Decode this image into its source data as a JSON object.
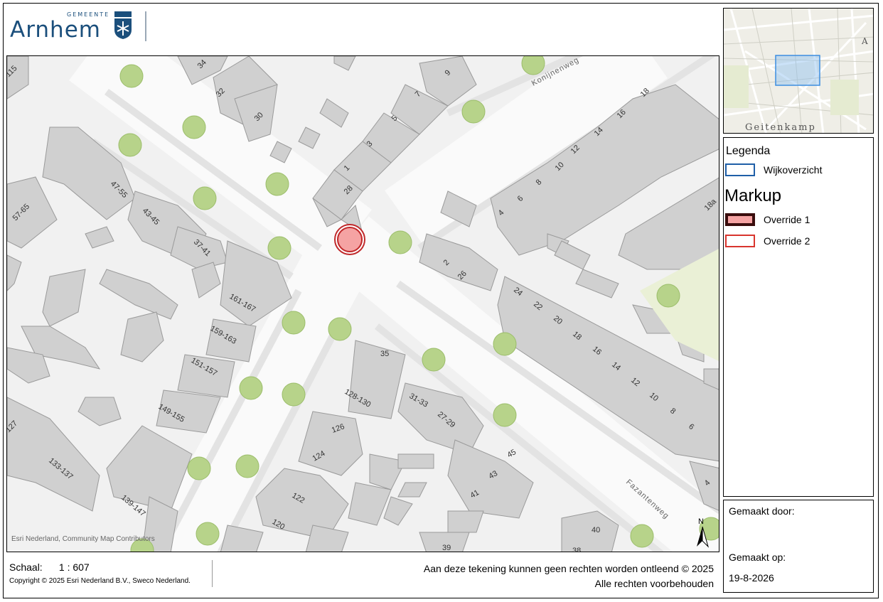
{
  "header": {
    "logo_sub": "GEMEENTE",
    "logo_name": "Arnhem",
    "logo_crest": "arnhem-crest-icon"
  },
  "map": {
    "attribution": "Esri Nederland, Community Map Contributors",
    "streets": [
      "Konijnenweg",
      "Fazantenweg"
    ],
    "house_numbers": [
      "115",
      "34",
      "32",
      "30",
      "9",
      "7",
      "5",
      "3",
      "1",
      "28",
      "47-55",
      "57-65",
      "43-45",
      "37-41",
      "161-167",
      "159-163",
      "151-157",
      "149-155",
      "127",
      "133-137",
      "139-147",
      "18",
      "16",
      "14",
      "12",
      "10",
      "8",
      "6",
      "4",
      "18a",
      "2",
      "26",
      "24",
      "22",
      "20",
      "18",
      "16",
      "14",
      "12",
      "10",
      "8",
      "6",
      "4",
      "35",
      "128-130",
      "31-33",
      "27-29",
      "126",
      "124",
      "45",
      "43",
      "41",
      "122",
      "120",
      "39",
      "40",
      "38"
    ],
    "north_label": "N",
    "marker_color": "#f5a3a3",
    "marker_stroke": "#c0282a"
  },
  "overview": {
    "place_label": "Geitenkamp",
    "corner_label": "A"
  },
  "legend": {
    "title": "Legenda",
    "items": [
      {
        "label": "Wijkoverzicht",
        "color": "#1f5fa8"
      }
    ],
    "markup_title": "Markup",
    "markup_items": [
      {
        "label": "Override 1",
        "fill": "#f5a3a3",
        "stroke": "#3a0d0d"
      },
      {
        "label": "Override 2",
        "fill": "#ffffff",
        "stroke": "#d9352e"
      }
    ]
  },
  "info": {
    "made_by_label": "Gemaakt door:",
    "made_on_label": "Gemaakt op:",
    "made_on_value": "19-8-2026"
  },
  "footer": {
    "scale_label": "Schaal:",
    "scale_value": "1 : 607",
    "copyright": "Copyright © 2025 Esri Nederland B.V., Sweco Nederland.",
    "disclaimer_1": "Aan deze tekening kunnen geen rechten worden ontleend © 2025",
    "disclaimer_2": "Alle rechten voorbehouden"
  }
}
